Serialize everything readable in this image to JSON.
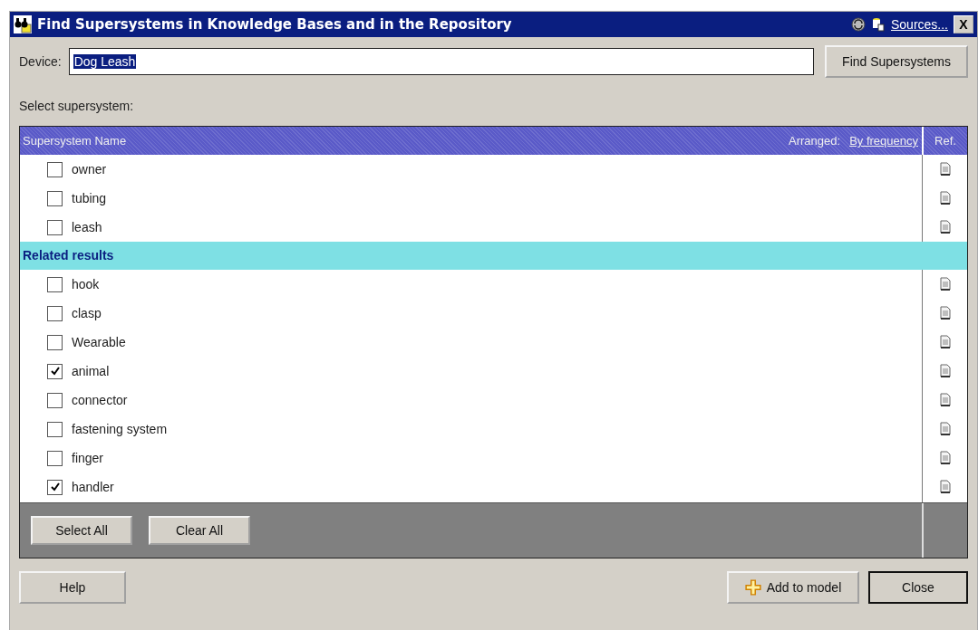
{
  "window": {
    "title": "Find Supersystems in Knowledge Bases and in the Repository",
    "sources_link": "Sources...",
    "close_glyph": "X"
  },
  "device": {
    "label": "Device:",
    "value": "Dog Leash",
    "button": "Find Supersystems"
  },
  "select_label": "Select supersystem:",
  "table": {
    "column_name": "Supersystem Name",
    "arranged_label": "Arranged:",
    "arranged_link": "By frequency",
    "column_ref": "Ref.",
    "sections": [
      {
        "rows": [
          {
            "name": "owner",
            "checked": false
          },
          {
            "name": "tubing",
            "checked": false
          },
          {
            "name": "leash",
            "checked": false
          }
        ]
      },
      {
        "header": "Related results",
        "rows": [
          {
            "name": "hook",
            "checked": false
          },
          {
            "name": "clasp",
            "checked": false
          },
          {
            "name": "Wearable",
            "checked": false
          },
          {
            "name": "animal",
            "checked": true
          },
          {
            "name": "connector",
            "checked": false
          },
          {
            "name": "fastening system",
            "checked": false
          },
          {
            "name": "finger",
            "checked": false
          },
          {
            "name": "handler",
            "checked": true
          }
        ]
      }
    ]
  },
  "table_buttons": [
    "Select All",
    "Clear All"
  ],
  "buttons": {
    "help": "Help",
    "add": "Add to model",
    "close": "Close"
  }
}
